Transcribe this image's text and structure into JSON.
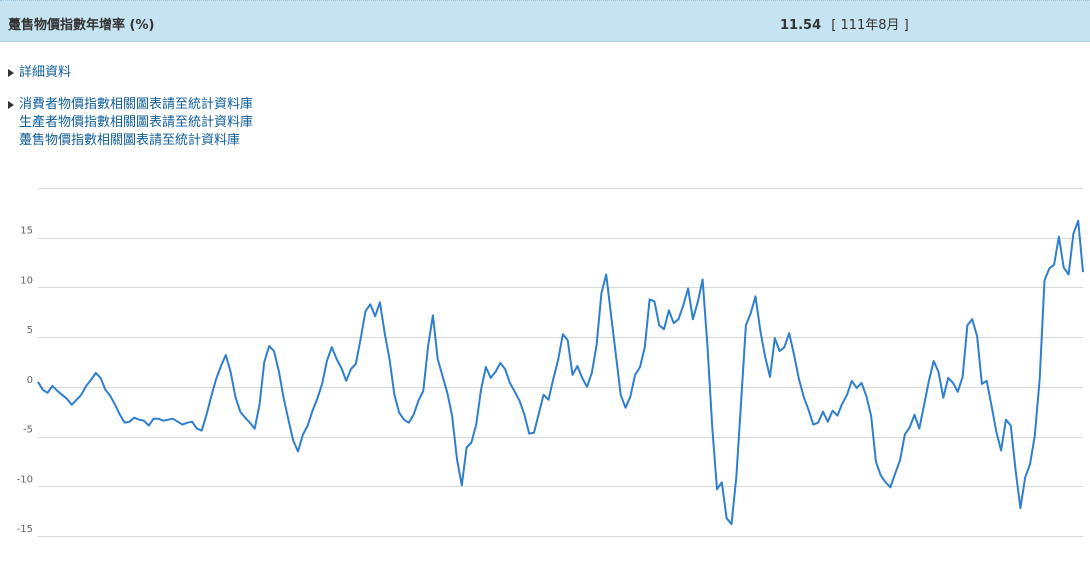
{
  "header": {
    "title": "躉售物價指數年增率 (%)",
    "value": "11.54",
    "date": "[ 111年8月 ]"
  },
  "links": {
    "detail": "詳細資料",
    "stats": [
      "消費者物價指數相關圖表請至統計資料庫",
      "生產者物價指數相關圖表請至統計資料庫",
      "躉售物價指數相關圖表請至統計資料庫"
    ]
  },
  "colors": {
    "header_bg": "#c6e3f2",
    "link": "#0f5e9a",
    "series": "#2e7fd0",
    "grid": "#d9d9d9"
  },
  "chart_data": {
    "type": "line",
    "title": "",
    "xlabel": "",
    "ylabel": "",
    "ylim": [
      -15,
      20
    ],
    "yticks": [
      -15,
      -10,
      -5,
      0,
      5,
      10,
      15
    ],
    "grid": true,
    "series": [
      {
        "values": [
          0.5,
          -0.3,
          -0.6,
          0.1,
          -0.4,
          -0.8,
          -1.2,
          -1.8,
          -1.3,
          -0.8,
          0.1,
          0.7,
          1.4,
          0.9,
          -0.3,
          -0.9,
          -1.8,
          -2.8,
          -3.6,
          -3.5,
          -3.1,
          -3.3,
          -3.4,
          -3.9,
          -3.2,
          -3.2,
          -3.4,
          -3.3,
          -3.2,
          -3.5,
          -3.8,
          -3.6,
          -3.5,
          -4.2,
          -4.4,
          -2.8,
          -0.9,
          0.8,
          2.1,
          3.2,
          1.5,
          -1.0,
          -2.5,
          -3.1,
          -3.6,
          -4.2,
          -1.8,
          2.5,
          4.1,
          3.6,
          1.6,
          -1.1,
          -3.3,
          -5.4,
          -6.5,
          -4.8,
          -3.9,
          -2.4,
          -1.2,
          0.3,
          2.6,
          4.0,
          2.8,
          1.9,
          0.6,
          1.8,
          2.3,
          4.8,
          7.6,
          8.3,
          7.1,
          8.5,
          5.4,
          2.8,
          -0.8,
          -2.6,
          -3.3,
          -3.6,
          -2.8,
          -1.4,
          -0.4,
          4.1,
          7.2,
          2.8,
          1.1,
          -0.6,
          -2.9,
          -7.3,
          -9.9,
          -6.1,
          -5.6,
          -3.8,
          -0.3,
          2.0,
          0.9,
          1.5,
          2.4,
          1.8,
          0.4,
          -0.5,
          -1.4,
          -2.8,
          -4.7,
          -4.6,
          -2.7,
          -0.8,
          -1.3,
          0.8,
          2.7,
          5.3,
          4.7,
          1.2,
          2.1,
          0.9,
          0.0,
          1.4,
          4.2,
          9.4,
          11.3,
          7.2,
          3.2,
          -0.8,
          -2.1,
          -1.0,
          1.2,
          2.0,
          4.0,
          8.8,
          8.6,
          6.2,
          5.8,
          7.7,
          6.4,
          6.8,
          8.2,
          9.9,
          6.8,
          8.5,
          10.8,
          4.2,
          -4.0,
          -10.3,
          -9.6,
          -13.2,
          -13.8,
          -9.1,
          -1.5,
          6.2,
          7.4,
          9.1,
          5.6,
          3.0,
          1.0,
          4.9,
          3.6,
          4.0,
          5.4,
          3.2,
          0.8,
          -1.0,
          -2.3,
          -3.8,
          -3.6,
          -2.5,
          -3.5,
          -2.4,
          -2.9,
          -1.7,
          -0.8,
          0.6,
          -0.1,
          0.4,
          -0.9,
          -2.9,
          -7.5,
          -8.9,
          -9.6,
          -10.1,
          -8.7,
          -7.4,
          -4.8,
          -4.1,
          -2.8,
          -4.2,
          -1.8,
          0.6,
          2.6,
          1.5,
          -1.1,
          0.9,
          0.4,
          -0.5,
          1.0,
          6.2,
          6.8,
          5.1,
          0.3,
          0.6,
          -1.9,
          -4.5,
          -6.4,
          -3.3,
          -3.9,
          -8.4,
          -12.2,
          -9.1,
          -7.8,
          -4.9,
          0.8,
          10.7,
          11.9,
          12.3,
          15.1,
          12.0,
          11.3,
          15.4,
          16.7,
          11.54
        ]
      }
    ]
  }
}
